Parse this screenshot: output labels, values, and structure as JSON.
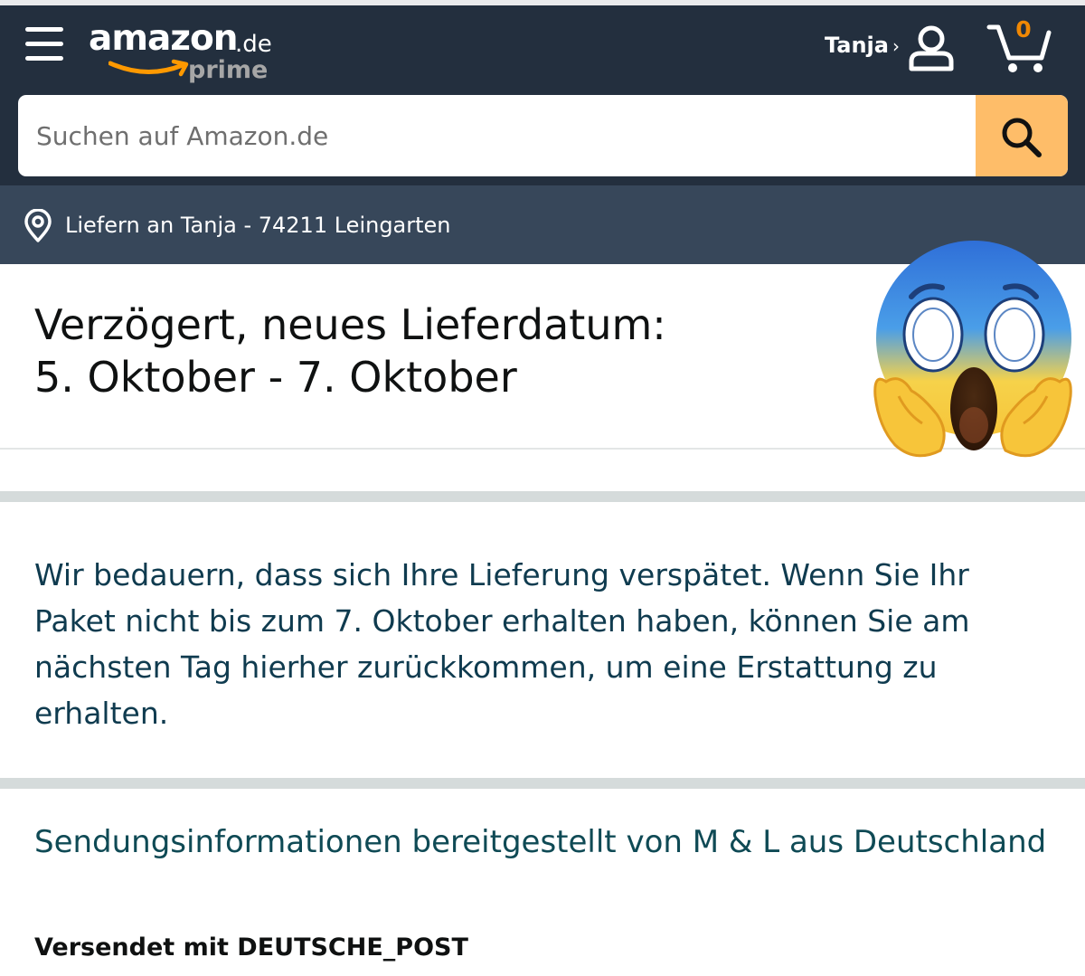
{
  "header": {
    "logo_word": "amazon",
    "logo_tld": ".de",
    "logo_sub": "prime",
    "account_name": "Tanja",
    "account_chevron": "›",
    "cart_count": "0",
    "icons": [
      "menu-icon",
      "person-icon",
      "cart-icon"
    ]
  },
  "search": {
    "placeholder": "Suchen auf Amazon.de",
    "value": "",
    "icon": "search-icon"
  },
  "delivery": {
    "icon": "location-pin-icon",
    "text": "Liefern an Tanja - 74211 Leingarten"
  },
  "status": {
    "line1": "Verzögert, neues Lieferdatum:",
    "line2": "5. Oktober - 7. Oktober"
  },
  "message": "Wir bedauern, dass sich Ihre Lieferung verspätet. Wenn Sie Ihr Paket nicht bis zum 7. Oktober erhalten haben, können Sie am nächsten Tag hierher zurückkommen, um eine Erstattung zu erhalten.",
  "carrier_info": "Sendungsinformationen bereitgestellt von M & L aus Deutschland",
  "shipped_with": "Versendet mit DEUTSCHE_POST",
  "colors": {
    "header_bg": "#232f3e",
    "subheader_bg": "#37475a",
    "search_button": "#febd69",
    "cart_count": "#f08804",
    "text_teal": "#0f4a55"
  },
  "overlay": {
    "icon": "screaming-face-emoji"
  }
}
